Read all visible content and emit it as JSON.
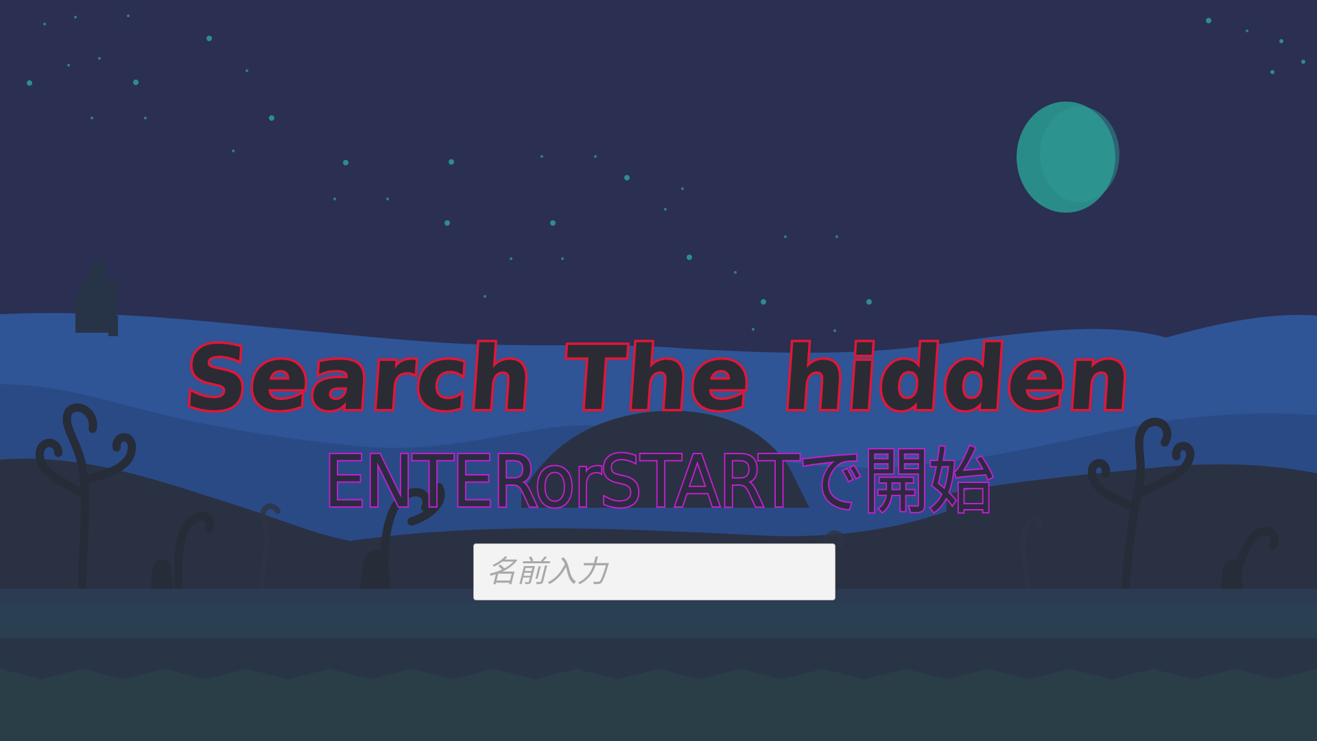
{
  "title": {
    "text": "Search The hidden"
  },
  "subtitle": {
    "text": "ENTERorSTARTで開始"
  },
  "name_input": {
    "placeholder": "名前入力",
    "value": ""
  },
  "colors": {
    "sky": "#2b2f52",
    "moon": "#2a8c88",
    "title_outline": "#e0183a",
    "subtitle_outline": "#c41fd0",
    "hills_far": "#2f5596",
    "hills_mid": "#2a4a86",
    "hills_dark": "#2a3142",
    "ground": "#2b3f52"
  }
}
